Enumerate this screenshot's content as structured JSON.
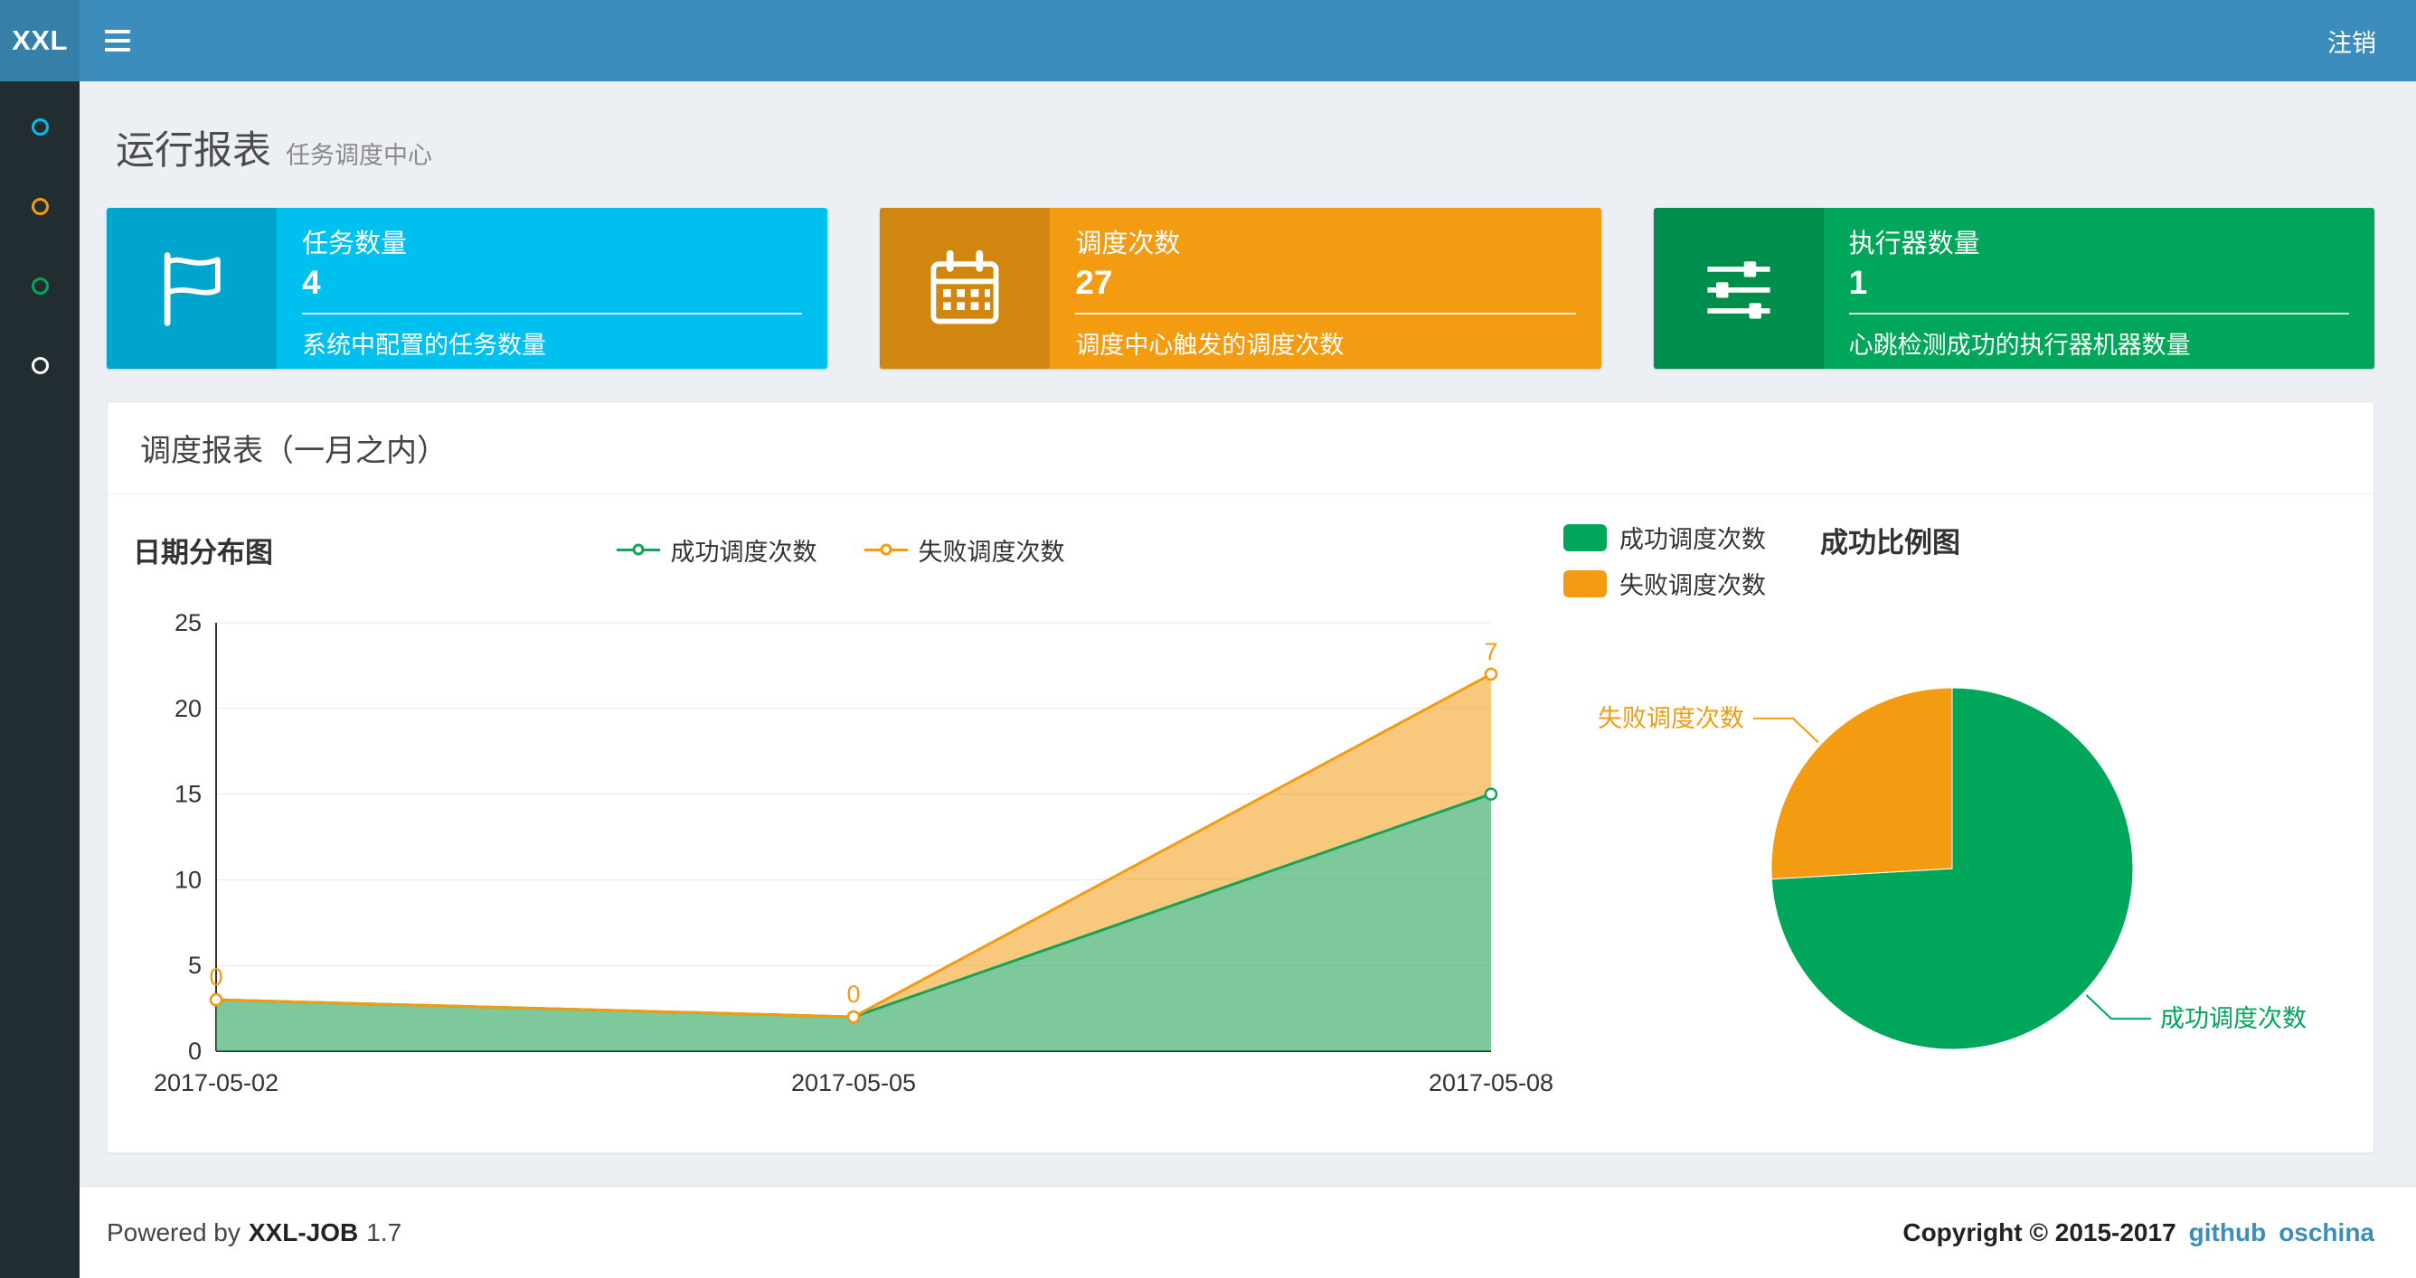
{
  "navbar": {
    "logo": "XXL",
    "logout": "注销"
  },
  "sidebar": {
    "items": [
      {
        "name": "menu-item-1",
        "color": "#00c0ef"
      },
      {
        "name": "menu-item-2",
        "color": "#f39c12"
      },
      {
        "name": "menu-item-3",
        "color": "#00a65a"
      },
      {
        "name": "menu-item-4",
        "color": "#ffffff"
      }
    ]
  },
  "page": {
    "title": "运行报表",
    "subtitle": "任务调度中心"
  },
  "info_boxes": [
    {
      "title": "任务数量",
      "value": "4",
      "desc": "系统中配置的任务数量",
      "color": "#00c0ef",
      "icon": "flag-icon"
    },
    {
      "title": "调度次数",
      "value": "27",
      "desc": "调度中心触发的调度次数",
      "color": "#f39c12",
      "icon": "calendar-icon"
    },
    {
      "title": "执行器数量",
      "value": "1",
      "desc": "心跳检测成功的执行器机器数量",
      "color": "#00a65a",
      "icon": "sliders-icon"
    }
  ],
  "panel": {
    "title": "调度报表（一月之内）"
  },
  "charts": {
    "line_title": "日期分布图",
    "pie_title": "成功比例图"
  },
  "chart_data": [
    {
      "type": "area",
      "title": "日期分布图",
      "x": [
        "2017-05-02",
        "2017-05-05",
        "2017-05-08"
      ],
      "series": [
        {
          "name": "成功调度次数",
          "values": [
            3,
            2,
            15
          ],
          "color": "#1aa158",
          "fill": "rgba(46,168,96,0.62)",
          "stack": true
        },
        {
          "name": "失败调度次数",
          "values": [
            0,
            0,
            7
          ],
          "color": "#f39c12",
          "fill": "rgba(243,156,18,0.55)",
          "stack": true,
          "point_labels": true
        }
      ],
      "ylim": [
        0,
        25
      ],
      "y_ticks": [
        0,
        5,
        10,
        15,
        20,
        25
      ],
      "legend": [
        "成功调度次数",
        "失败调度次数"
      ],
      "legend_position": "top-center",
      "grid": true
    },
    {
      "type": "pie",
      "title": "成功比例图",
      "slices": [
        {
          "name": "成功调度次数",
          "value": 20,
          "color": "#00a65a"
        },
        {
          "name": "失败调度次数",
          "value": 7,
          "color": "#f39c12"
        }
      ],
      "legend": [
        "成功调度次数",
        "失败调度次数"
      ],
      "legend_position": "top-left"
    }
  ],
  "footer": {
    "powered_by": "Powered by",
    "product": "XXL-JOB",
    "version": "1.7",
    "copyright": "Copyright © 2015-2017",
    "links": [
      "github",
      "oschina"
    ]
  }
}
